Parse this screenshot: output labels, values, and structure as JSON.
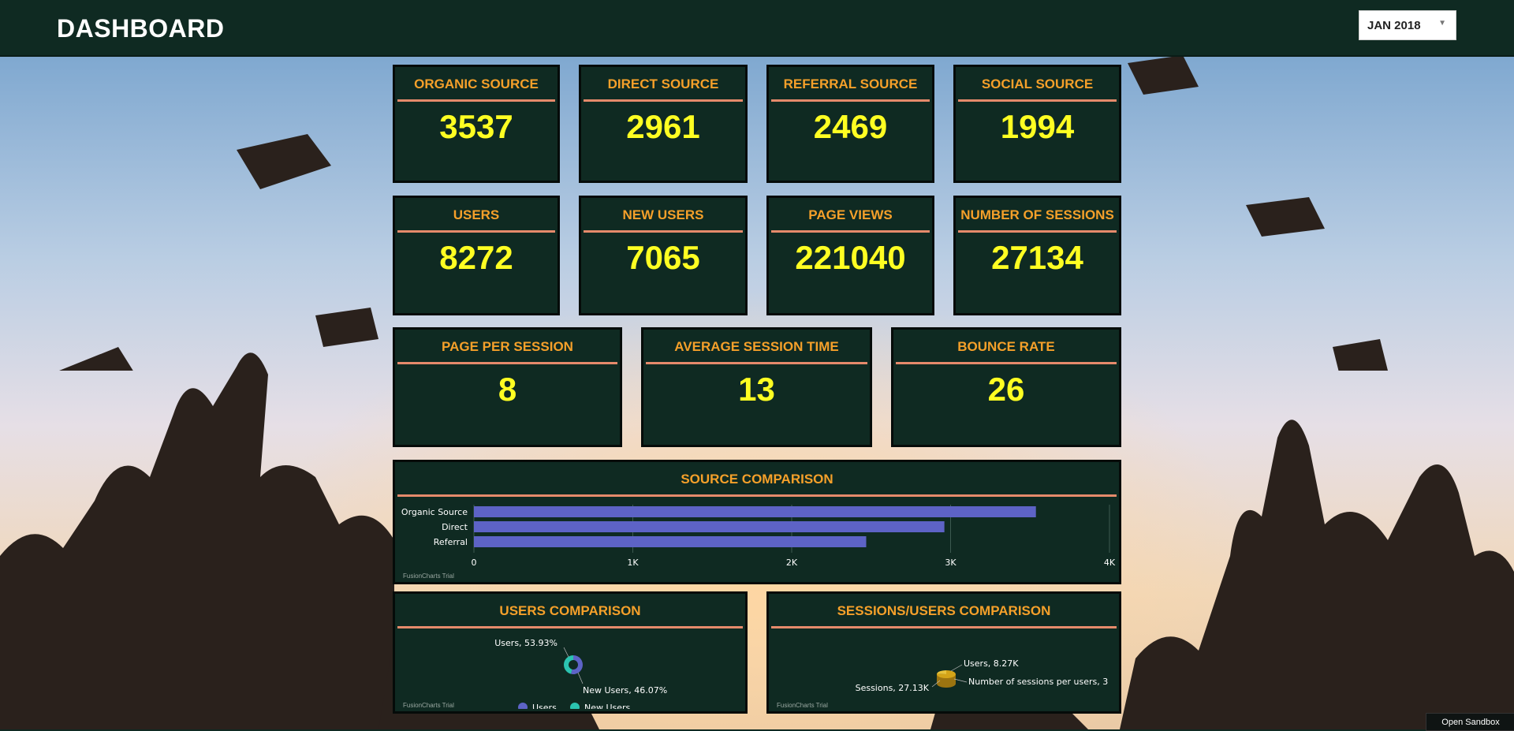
{
  "header": {
    "title": "DASHBOARD",
    "month_select": "JAN 2018"
  },
  "kpis": [
    {
      "label": "ORGANIC SOURCE",
      "value": "3537"
    },
    {
      "label": "DIRECT SOURCE",
      "value": "2961"
    },
    {
      "label": "REFERRAL SOURCE",
      "value": "2469"
    },
    {
      "label": "SOCIAL SOURCE",
      "value": "1994"
    },
    {
      "label": "USERS",
      "value": "8272"
    },
    {
      "label": "NEW USERS",
      "value": "7065"
    },
    {
      "label": "PAGE VIEWS",
      "value": "221040"
    },
    {
      "label": "NUMBER OF SESSIONS",
      "value": "27134"
    },
    {
      "label": "PAGE PER SESSION",
      "value": "8"
    },
    {
      "label": "AVERAGE SESSION TIME",
      "value": "13"
    },
    {
      "label": "BOUNCE RATE",
      "value": "26"
    }
  ],
  "source_chart": {
    "title": "SOURCE COMPARISON",
    "trial": "FusionCharts Trial"
  },
  "users_chart": {
    "title": "USERS COMPARISON",
    "trial": "FusionCharts Trial"
  },
  "sessions_chart": {
    "title": "SESSIONS/USERS COMPARISON",
    "trial": "FusionCharts Trial"
  },
  "footer": {
    "sandbox": "Open Sandbox"
  },
  "colors": {
    "panel": "#0f2a22",
    "accent": "#f5a02a",
    "value": "#ffff22",
    "bar": "#5d63c6",
    "teal": "#2bc3b0"
  },
  "chart_data": [
    {
      "type": "bar",
      "orientation": "horizontal",
      "categories": [
        "Organic Source",
        "Direct",
        "Referral"
      ],
      "values": [
        3537,
        2961,
        2469
      ],
      "xlim": [
        0,
        4000
      ],
      "ticks": [
        "0",
        "1K",
        "2K",
        "3K",
        "4K"
      ]
    },
    {
      "type": "pie",
      "style": "doughnut",
      "slices": [
        {
          "name": "Users",
          "percent": 53.93,
          "label": "Users, 53.93%"
        },
        {
          "name": "New Users",
          "percent": 46.07,
          "label": "New Users, 46.07%"
        }
      ],
      "legend": [
        "Users",
        "New Users"
      ]
    },
    {
      "type": "pie",
      "style": "3d",
      "slices": [
        {
          "name": "Sessions",
          "value": 27130,
          "label": "Sessions, 27.13K"
        },
        {
          "name": "Users",
          "value": 8270,
          "label": "Users, 8.27K"
        },
        {
          "name": "Number of sessions per users",
          "value": 3,
          "label": "Number of sessions per users, 3"
        }
      ]
    }
  ]
}
